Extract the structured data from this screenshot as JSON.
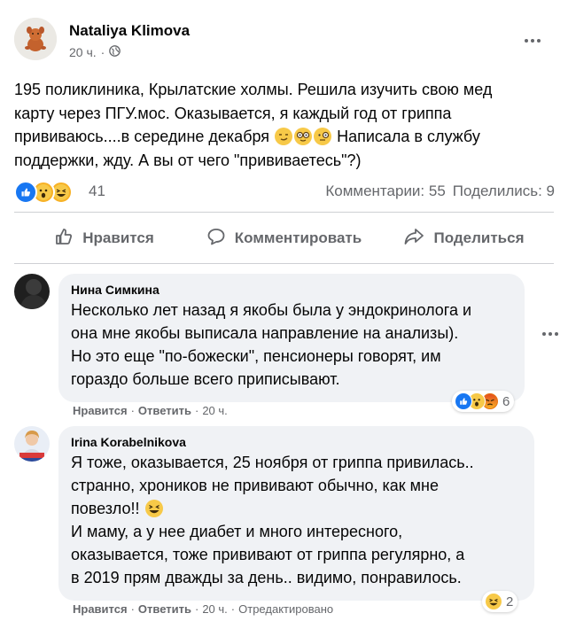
{
  "post": {
    "author": "Nataliya Klimova",
    "time": "20 ч.",
    "separator": "·",
    "text": [
      "195 поликлиника, Крылатские холмы. Решила изучить свою мед",
      "карту через ПГУ.мос. Оказывается, я каждый год от гриппа",
      "прививаюсь....в середине декабря",
      " Написала в службу",
      "поддержки, жду.  А вы от чего \"прививаетесь\"?)"
    ],
    "reaction_count": "41",
    "comments_stat": "Комментарии: 55",
    "shares_stat": "Поделились: 9",
    "colors": {
      "like": "#1877f2",
      "wow": "#f7b125",
      "haha": "#f7b125",
      "angry": "#e9710f"
    }
  },
  "actions": {
    "like": "Нравится",
    "comment": "Комментировать",
    "share": "Поделиться"
  },
  "comments": [
    {
      "name": "Нина Симкина",
      "lines": [
        "Несколько лет назад я якобы была у эндокринолога и",
        "она мне якобы выписала направление на анализы).",
        "Но это еще \"по-божески\", пенсионеры говорят, им",
        "гораздо больше всего приписывают."
      ],
      "like": "Нравится",
      "reply": "Ответить",
      "time": "20 ч.",
      "reaction_count": "6"
    },
    {
      "name": "Irina Korabelnikova",
      "lines": [
        "Я тоже, оказывается, 25 ноября от гриппа привилась..",
        "странно, хроников не прививают обычно, как мне",
        "повезло!! ",
        "И маму, а у нее диабет и много интересного,",
        "оказывается, тоже прививают от гриппа регулярно, а",
        "в 2019 прям дважды за день.. видимо, понравилось."
      ],
      "like": "Нравится",
      "reply": "Ответить",
      "time": "20 ч.",
      "edited": "Отредактировано",
      "reaction_count": "2"
    }
  ]
}
